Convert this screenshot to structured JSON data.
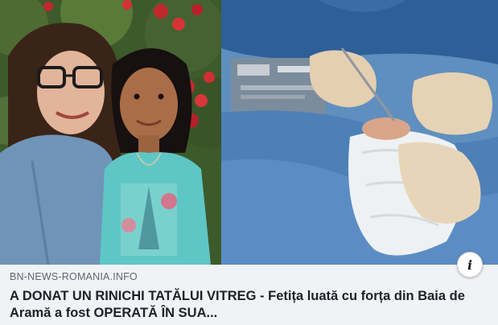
{
  "link_preview": {
    "domain": "BN-NEWS-ROMANIA.INFO",
    "headline": "A DONAT UN RINICHI TATĂLUI VITREG - Fetița luată cu forța din Baia de Aramă a fost OPERATĂ ÎN SUA...",
    "images": [
      {
        "subject": "woman-and-girl-photo"
      },
      {
        "subject": "surgery-photo"
      }
    ],
    "info_icon": "info-icon"
  },
  "colors": {
    "card_background": "#f0f2f5",
    "domain_text": "#606770",
    "headline_text": "#1d2129"
  }
}
